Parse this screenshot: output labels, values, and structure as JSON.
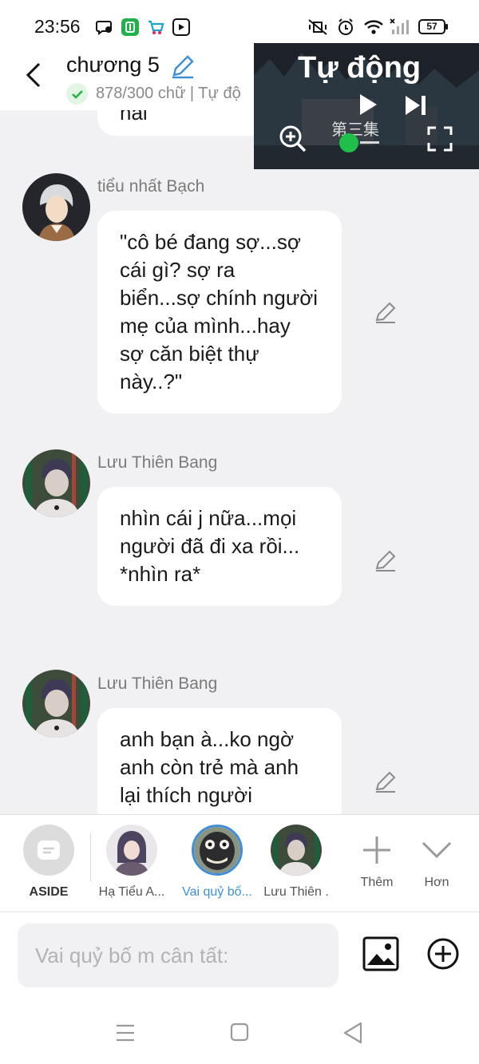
{
  "status_bar": {
    "time": "23:56",
    "battery": "57",
    "app_icons": [
      "chat-app-icon",
      "green-app-icon",
      "cart-app-icon",
      "play-app-icon"
    ],
    "system_icons": [
      "mute-vibrate-icon",
      "alarm-icon",
      "wifi-icon",
      "signal-icon",
      "battery-icon"
    ]
  },
  "header": {
    "title": "chương 5",
    "subtitle": "878/300 chữ | Tự độ"
  },
  "video": {
    "title": "Tự động",
    "subtitle": "第三集"
  },
  "chat": {
    "partial_text": "hai",
    "messages": [
      {
        "speaker": "tiểu nhất Bạch",
        "text": "\"cô bé đang sợ...sợ cái gì? sợ ra biển...sợ chính người mẹ của mình...hay sợ căn biệt thự này..?\""
      },
      {
        "speaker": "Lưu Thiên Bang",
        "text": "nhìn cái j nữa...mọi người đã đi xa rồi... *nhìn ra*"
      },
      {
        "speaker": "Lưu Thiên Bang",
        "text": "anh bạn à...ko ngờ anh còn trẻ mà anh lại thích người"
      }
    ]
  },
  "characters": {
    "aside_label": "ASIDE",
    "items": [
      {
        "label": "Hạ Tiểu A..."
      },
      {
        "label": "Vai quỷ bố..."
      },
      {
        "label": "Lưu Thiên ."
      }
    ],
    "add_label": "Thêm",
    "more_label": "Hơn"
  },
  "composer": {
    "placeholder": "Vai quỷ bố m cân tất:"
  },
  "colors": {
    "accent_blue": "#3d8fd9",
    "check_green": "#27b34a",
    "chat_bg": "#f1f1f3",
    "bubble_bg": "#ffffff",
    "video_dot_green": "#1fc04a"
  }
}
